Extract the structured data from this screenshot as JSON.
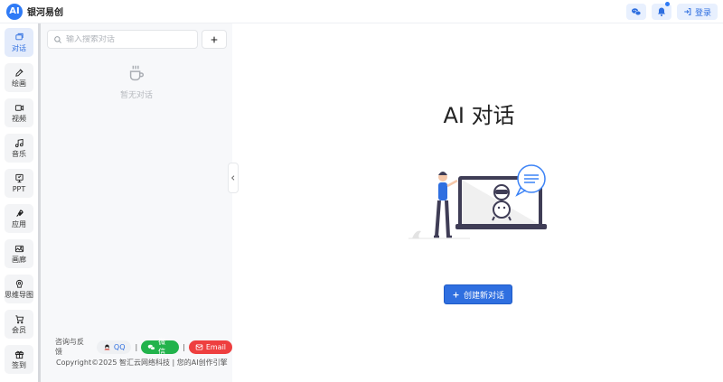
{
  "brand": {
    "logo_text": "AI",
    "name": "银河易创"
  },
  "topbar": {
    "login_label": "登录"
  },
  "nav": {
    "items": [
      {
        "label": "对话",
        "icon": "chat-icon",
        "active": true
      },
      {
        "label": "绘画",
        "icon": "brush-icon",
        "active": false
      },
      {
        "label": "视频",
        "icon": "video-icon",
        "active": false
      },
      {
        "label": "音乐",
        "icon": "music-icon",
        "active": false
      },
      {
        "label": "PPT",
        "icon": "presentation-icon",
        "active": false
      },
      {
        "label": "应用",
        "icon": "rocket-icon",
        "active": false
      },
      {
        "label": "画廊",
        "icon": "gallery-icon",
        "active": false
      },
      {
        "label": "思维导图",
        "icon": "mindmap-icon",
        "active": false
      },
      {
        "label": "会员",
        "icon": "cart-icon",
        "active": false
      },
      {
        "label": "签到",
        "icon": "gift-icon",
        "active": false
      }
    ]
  },
  "panel": {
    "search_placeholder": "输入搜索对话",
    "empty_text": "暂无对话"
  },
  "footer": {
    "consult_label": "咨询与反馈",
    "qq_label": "QQ",
    "wechat_label": "微信",
    "email_label": "Email",
    "separator": "|",
    "copyright": "Copyright©2025 智汇云网络科技 | 您的AI创作引擎"
  },
  "main": {
    "title": "AI 对话",
    "create_button_label": "创建新对话"
  },
  "colors": {
    "accent": "#2f6fe0",
    "wechat": "#22b34c",
    "email": "#ee3f3f",
    "panel_bg": "#f7f8fa"
  }
}
